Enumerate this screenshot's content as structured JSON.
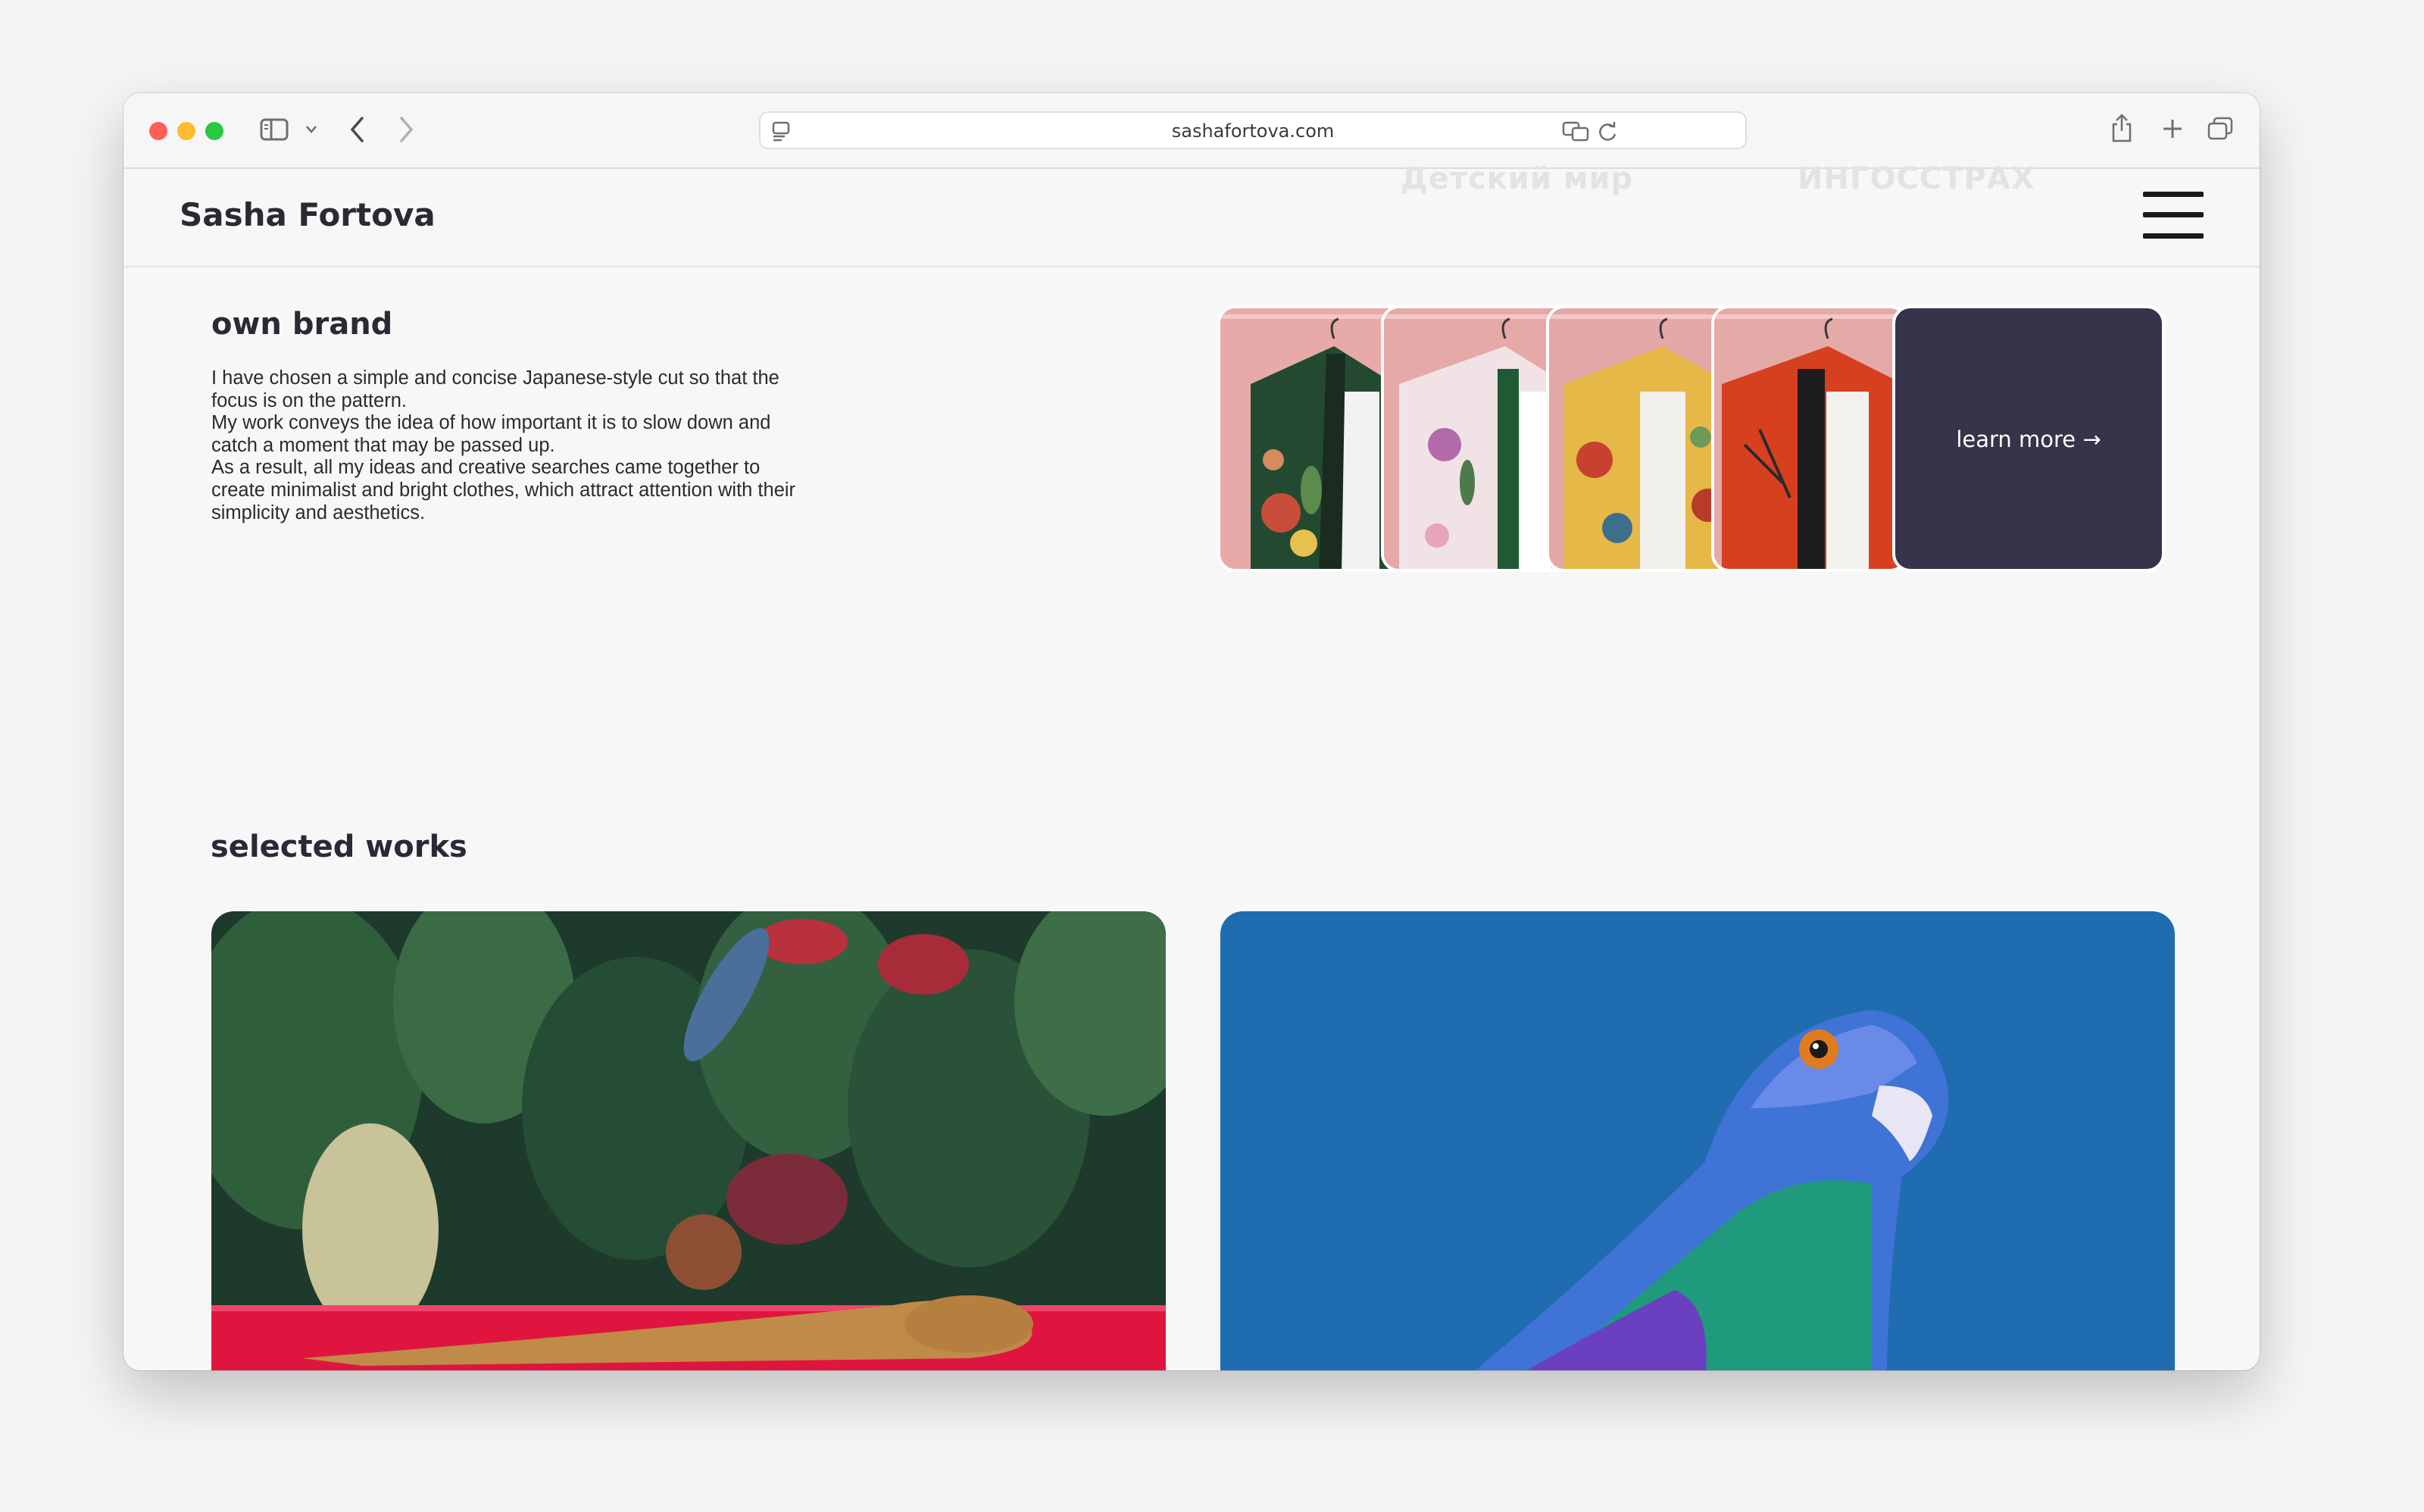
{
  "browser": {
    "url": "sashafortova.com"
  },
  "site": {
    "brand": "Sasha Fortova",
    "ghost_logos": [
      "Детский мир",
      "ИНГОССТРАХ"
    ]
  },
  "own_brand": {
    "heading": "own brand",
    "paragraphs": [
      "I have chosen a simple and concise Japanese-style cut so that the focus is on the pattern.",
      "My work conveys the idea of how important it is to slow down and catch a moment that may be passed up.",
      "As a result, all my ideas and creative searches came together to create minimalist and bright clothes, which attract attention with their simplicity and aesthetics."
    ],
    "learn_more": "learn more →"
  },
  "selected_works": {
    "heading": "selected works"
  },
  "colors": {
    "accent_dark": "#35344a",
    "work_blue": "#1f6cb0"
  }
}
